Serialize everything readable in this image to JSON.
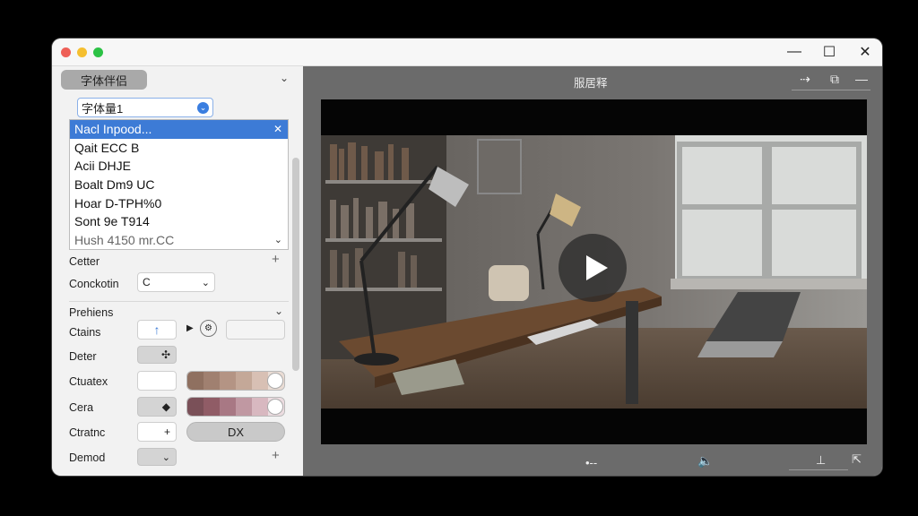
{
  "titlebar": {
    "close_glyph": "✕",
    "maximize_glyph": "☐",
    "minimize_glyph": "—"
  },
  "left_panel": {
    "group_pill_label": "字体伴侣",
    "font_input_value": "字体量1",
    "dropdown_items": [
      "Nacl Inpood...",
      "Qait ECC B",
      "Acii DHJE",
      "Boalt Dm9 UC",
      "Hoar D-TPH%0",
      "Sont 9e T914",
      "Hush 4150 mr.CC"
    ],
    "rows": {
      "cetter": {
        "label": "Cetter"
      },
      "conckotin": {
        "label": "Conckotin",
        "select_value": "C"
      },
      "section_title": "Prehiens",
      "ctains": {
        "label": "Ctains"
      },
      "deter": {
        "label": "Deter"
      },
      "ctuatex": {
        "label": "Ctuatex"
      },
      "cera": {
        "label": "Cera"
      },
      "ctratnc": {
        "label": "Ctratnc",
        "button_label": "DX"
      },
      "demod": {
        "label": "Demod"
      }
    }
  },
  "right_panel": {
    "title": "服居释"
  },
  "colors": {
    "accent": "#3d7bd6",
    "panel_bg": "#f2f2f2",
    "viewer_bg": "#6b6b6b"
  }
}
